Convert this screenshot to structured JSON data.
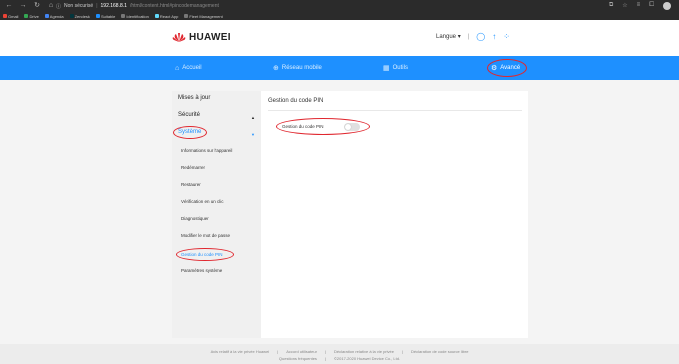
{
  "browser": {
    "security_label": "Non sécurisé",
    "host": "192.168.8.1",
    "path": "/html/content.html#pincodemanagement",
    "bookmarks": [
      {
        "label": "Gmail",
        "color": "#ea4335"
      },
      {
        "label": "Drive",
        "color": "#34a853"
      },
      {
        "label": "Agenda",
        "color": "#4285f4"
      },
      {
        "label": "Zendesk",
        "color": "#03363d"
      },
      {
        "label": "Suitable",
        "color": "#1e90ff"
      },
      {
        "label": "Identification",
        "color": "#777777"
      },
      {
        "label": "React App",
        "color": "#61dafb"
      },
      {
        "label": "Fleet Management",
        "color": "#777777"
      }
    ]
  },
  "header": {
    "brand": "HUAWEI",
    "language": "Langue",
    "language_caret": "▾",
    "separator": "|"
  },
  "nav": {
    "items": [
      {
        "label": "Accueil",
        "icon": "⌂"
      },
      {
        "label": "Réseau mobile",
        "icon": "⊕"
      },
      {
        "label": "Outils",
        "icon": "▦"
      },
      {
        "label": "Avancé",
        "icon": "⚙"
      }
    ]
  },
  "sidebar": {
    "l1": [
      "Mises à jour",
      "Sécurité",
      "Système"
    ],
    "l2": [
      "Informations sur l'appareil",
      "Redémarrer",
      "Restaurer",
      "Vérification en un clic",
      "Diagnostiquer",
      "Modifier le mot de passe",
      "Gestion du code PIN",
      "Paramètres système"
    ]
  },
  "main": {
    "title": "Gestion du code PIN",
    "pin_label": "Gestion du code PIN",
    "pin_enabled": false
  },
  "footer": {
    "row1": [
      "Avis relatif à la vie privée Huawei",
      "|",
      "Accord utilisateur",
      "|",
      "Déclaration relative à la vie privée",
      "|",
      "Déclaration de code source libre"
    ],
    "row2": [
      "Questions fréquentes",
      "|",
      "©2017-2020 Huawei Device Co., Ltd."
    ]
  },
  "colors": {
    "accent": "#1e90ff",
    "highlight": "#e0272f",
    "brand": "#e0272f"
  }
}
